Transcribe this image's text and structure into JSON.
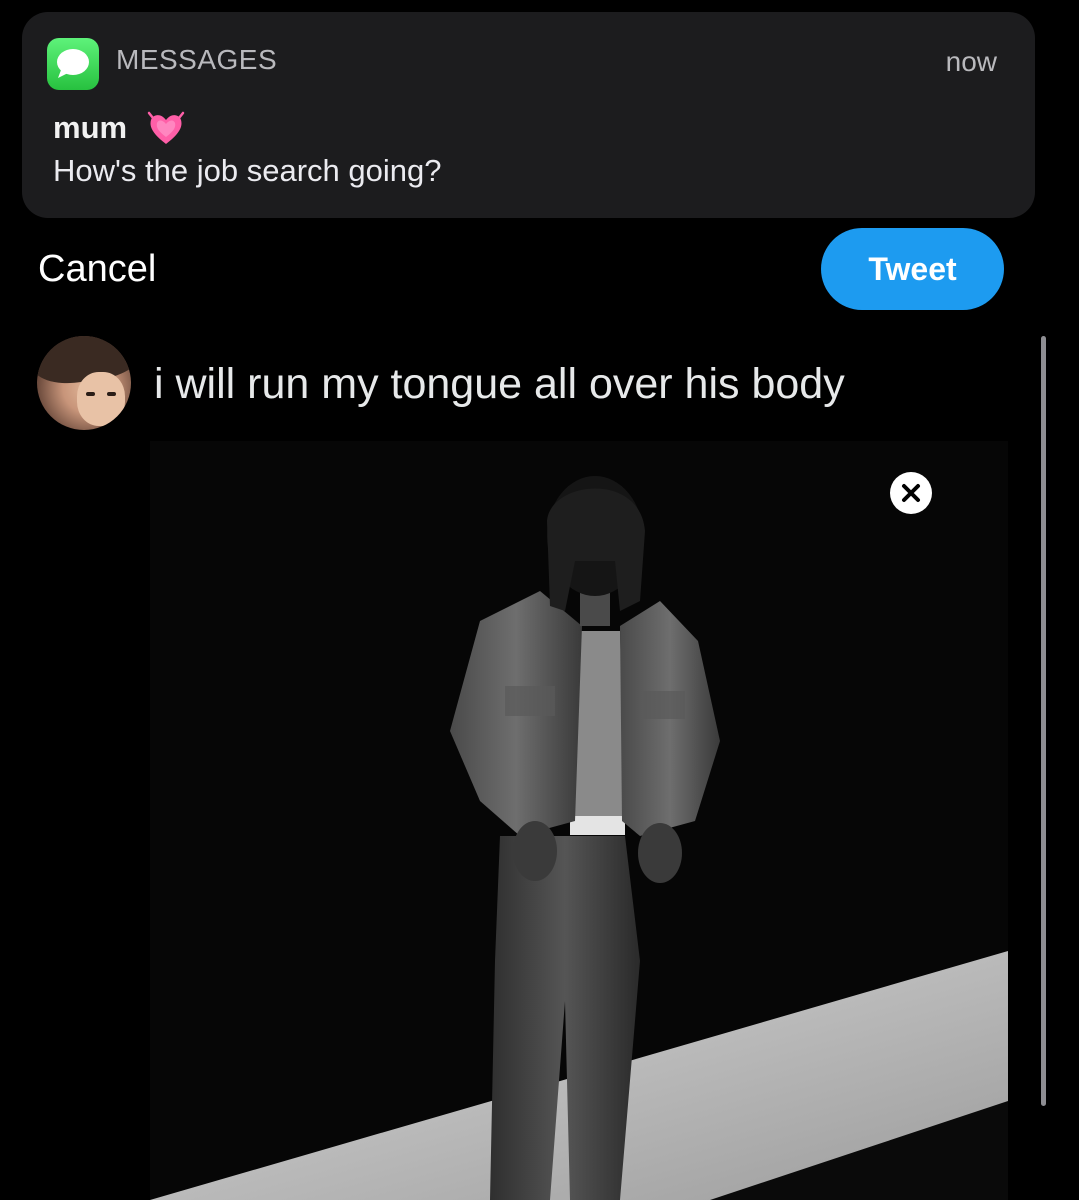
{
  "notification": {
    "app_name": "MESSAGES",
    "time": "now",
    "sender": "mum",
    "sender_emoji": "growing-heart-icon",
    "body": "How's the job search going?"
  },
  "compose": {
    "cancel_label": "Cancel",
    "tweet_label": "Tweet",
    "tweet_text": "i will run my tongue all over his body",
    "media_close_icon": "close-icon"
  },
  "colors": {
    "tweet_button": "#1d9bf0",
    "notification_bg": "#1c1c1e",
    "messages_icon": "#34c759",
    "heart": "#ff5fa8",
    "background": "#000000"
  }
}
